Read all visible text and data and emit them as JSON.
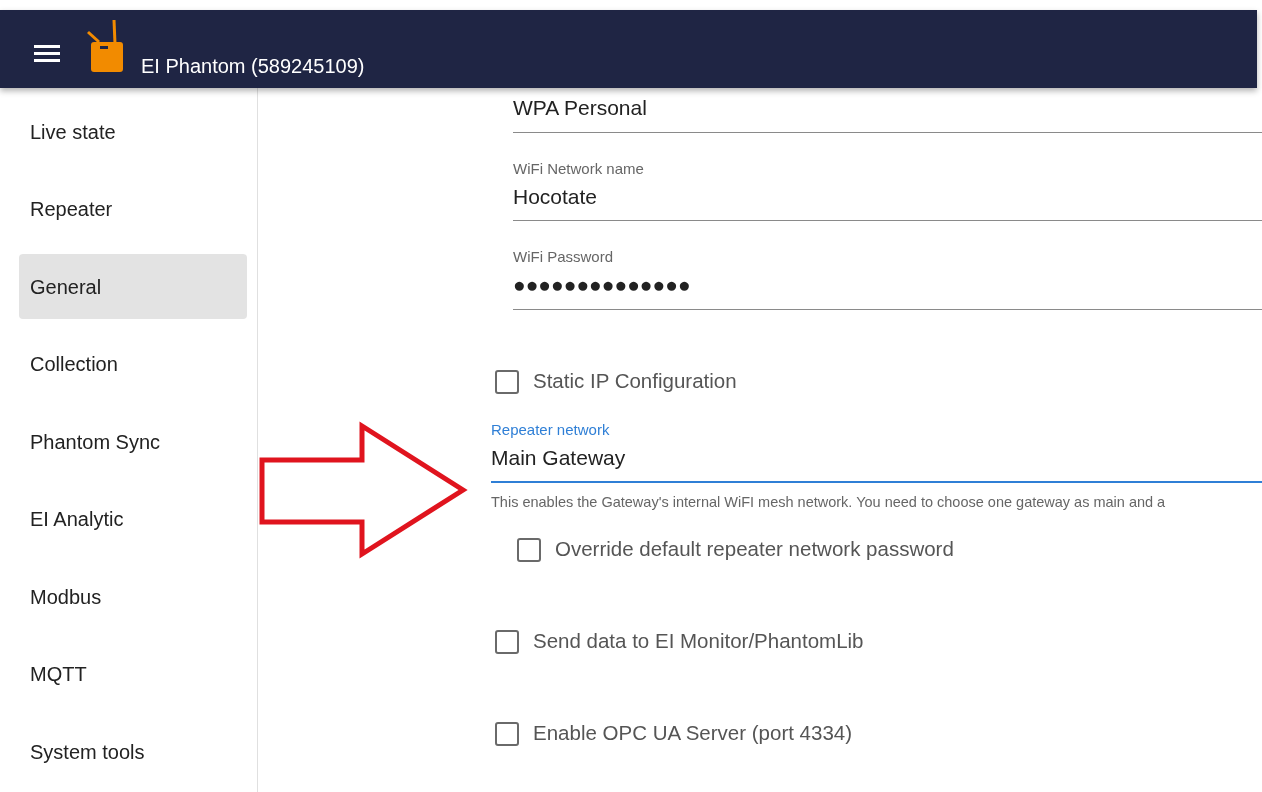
{
  "header": {
    "title": "EI Phantom (589245109)"
  },
  "sidebar": {
    "items": [
      {
        "label": "Live state",
        "selected": false
      },
      {
        "label": "Repeater",
        "selected": false
      },
      {
        "label": "General",
        "selected": true
      },
      {
        "label": "Collection",
        "selected": false
      },
      {
        "label": "Phantom Sync",
        "selected": false
      },
      {
        "label": "EI Analytic",
        "selected": false
      },
      {
        "label": "Modbus",
        "selected": false
      },
      {
        "label": "MQTT",
        "selected": false
      },
      {
        "label": "System tools",
        "selected": false
      }
    ]
  },
  "form": [
    {
      "kind": "field",
      "value": "WPA Personal",
      "focused": false,
      "indented": true
    },
    {
      "kind": "field",
      "label": "WiFi Network name",
      "value": "Hocotate",
      "focused": false,
      "indented": true
    },
    {
      "kind": "field",
      "label": "WiFi Password",
      "value": "●●●●●●●●●●●●●●",
      "focused": false,
      "indented": true
    },
    {
      "kind": "checkbox",
      "label": "Static IP Configuration",
      "checked": false
    },
    {
      "kind": "field",
      "label": "Repeater network",
      "value": "Main Gateway",
      "focused": true,
      "indented": false,
      "helper": "This enables the Gateway's internal WiFI mesh network. You need to choose one gateway as main and a",
      "children": [
        {
          "kind": "checkbox",
          "label": "Override default repeater network password",
          "checked": false
        }
      ]
    },
    {
      "kind": "checkbox",
      "label": "Send data to EI Monitor/PhantomLib",
      "checked": false
    },
    {
      "kind": "checkbox",
      "label": "Enable OPC UA Server (port 4334)",
      "checked": false
    }
  ]
}
